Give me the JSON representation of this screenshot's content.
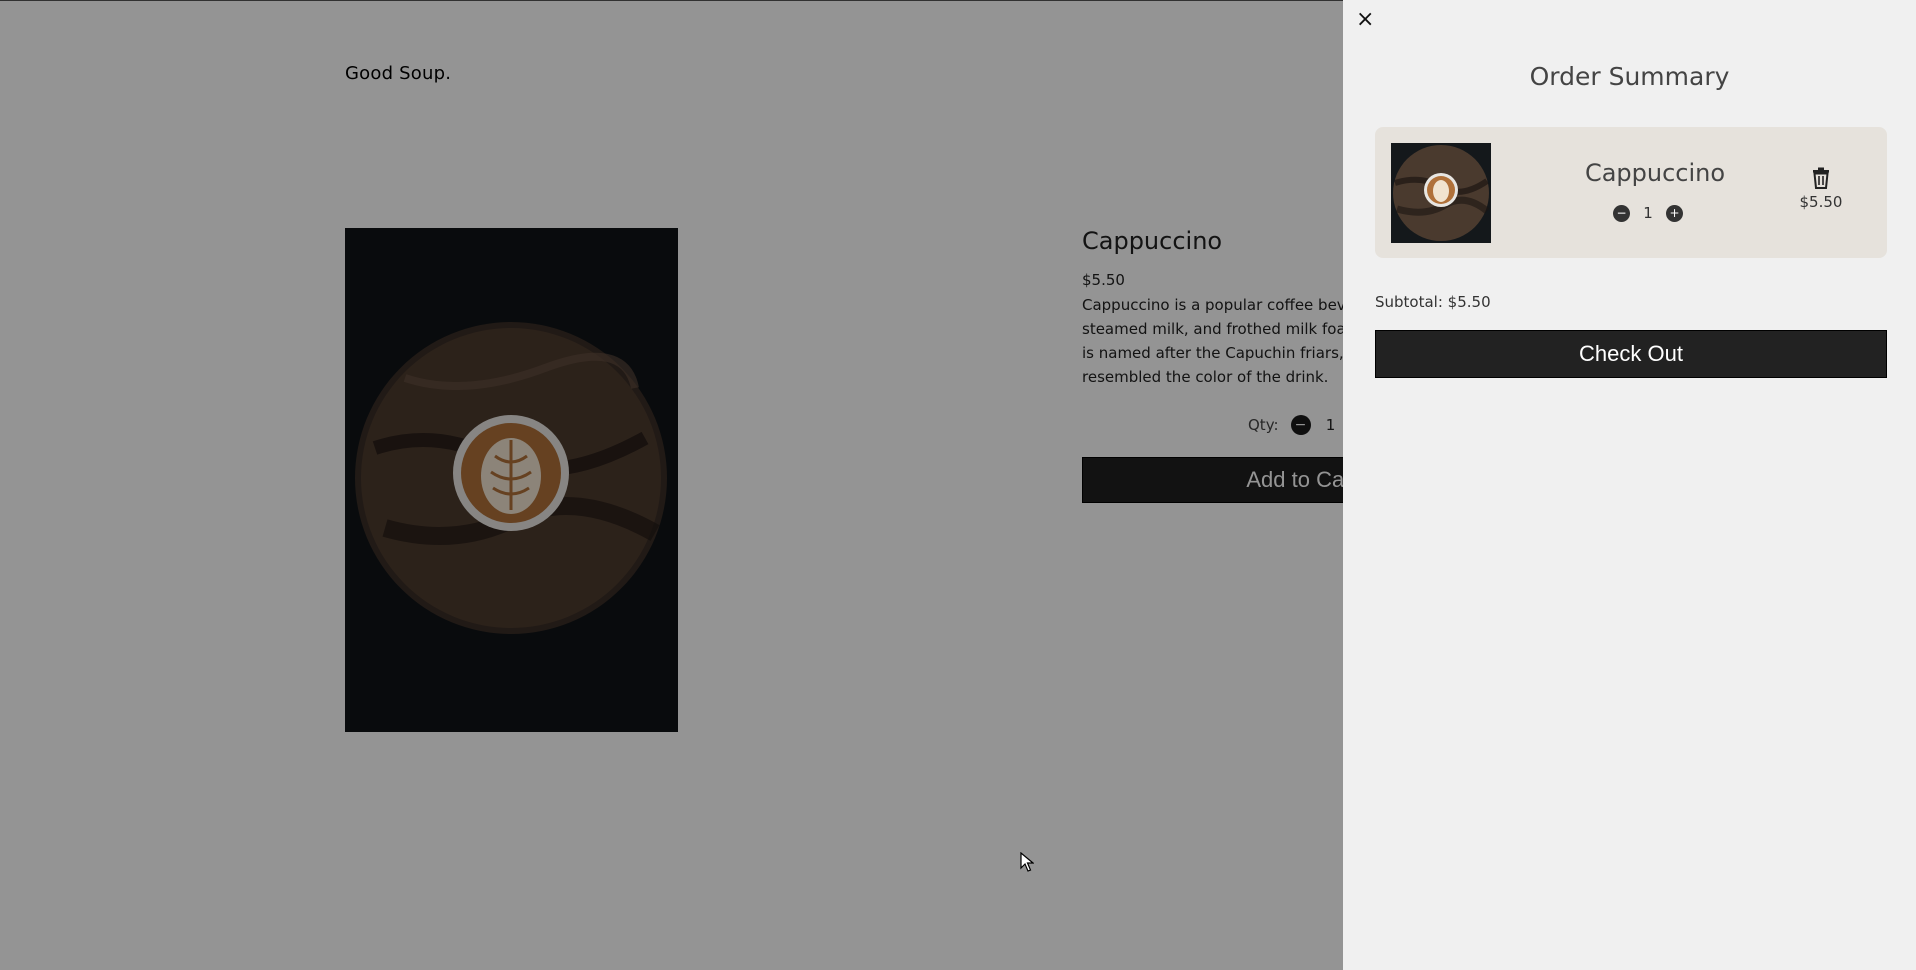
{
  "page": {
    "brand": "Good Soup.",
    "product": {
      "title": "Cappuccino",
      "price": "$5.50",
      "description": "Cappuccino is a popular coffee beverage made with espresso, steamed milk, and frothed milk foam. It originated in Italy and is named after the Capuchin friars, whose brown robes that resembled the color of the drink.",
      "qty_label": "Qty:",
      "qty_value": "1",
      "add_button_label": "Add to Cart"
    }
  },
  "drawer": {
    "close_icon": "×",
    "title": "Order Summary",
    "items": [
      {
        "name": "Cappuccino",
        "quantity": "1",
        "price": "$5.50",
        "minus_icon": "−",
        "plus_icon": "+"
      }
    ],
    "subtotal": "Subtotal: $5.50",
    "checkout_label": "Check Out"
  }
}
